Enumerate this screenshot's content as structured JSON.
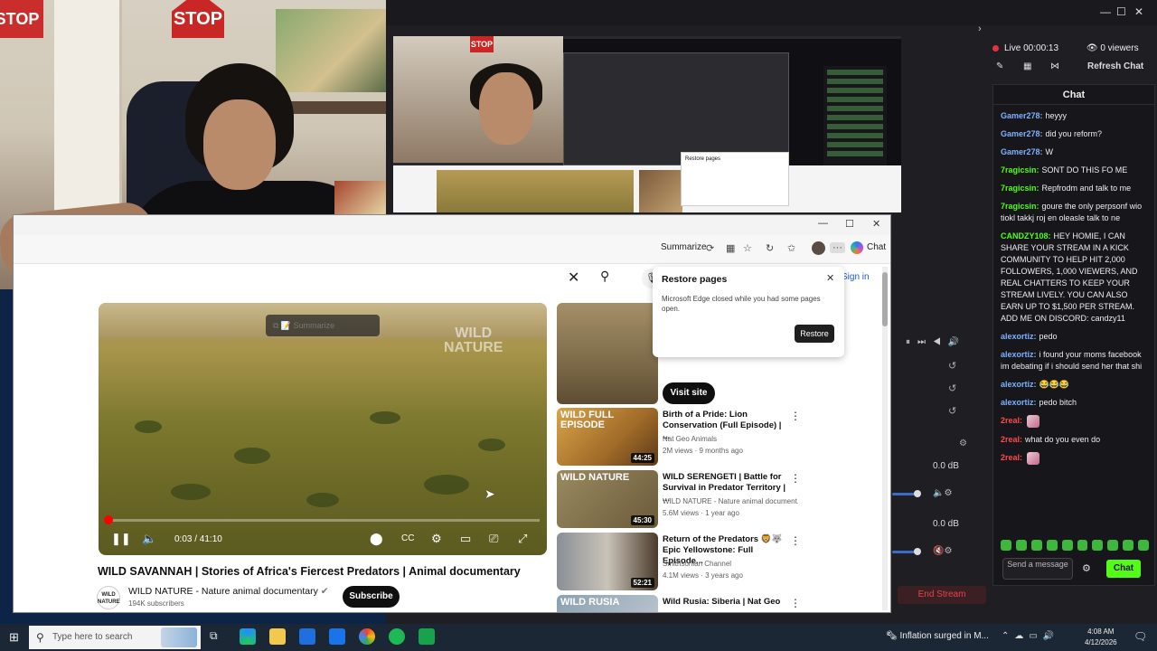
{
  "webcam": {
    "stop_sign": "STOP"
  },
  "obs": {
    "live_time": "Live 00:00:13",
    "viewers": "0 viewers",
    "refresh_chat": "Refresh Chat",
    "chat_title": "Chat",
    "send_placeholder": "Send a message",
    "send_label": "Chat",
    "end_stream": "End Stream",
    "db1": "0.0 dB",
    "db2": "0.0 dB",
    "preview_stop": "STOP",
    "preview_restore": "Restore pages",
    "messages": [
      {
        "user": "Gamer278:",
        "text": "heyyy",
        "color": "#7fb0ff"
      },
      {
        "user": "Gamer278:",
        "text": "did you reform?",
        "color": "#7fb0ff"
      },
      {
        "user": "Gamer278:",
        "text": "W",
        "color": "#7fb0ff"
      },
      {
        "user": "7ragicsin:",
        "text": "SONT DO THIS FO ME",
        "color": "#53fc18"
      },
      {
        "user": "7ragicsin:",
        "text": "Repfrodm and talk to me",
        "color": "#53fc18"
      },
      {
        "user": "7ragicsin:",
        "text": "goure the only perpsonf wio tiokl takkj roj en oleasle talk to ne",
        "color": "#53fc18"
      },
      {
        "user": "CANDZY108:",
        "text": "HEY HOMIE, I CAN SHARE YOUR STREAM IN A KICK COMMUNITY TO HELP HIT 2,000 FOLLOWERS, 1,000 VIEWERS, AND REAL CHATTERS TO KEEP YOUR STREAM LIVELY. YOU CAN ALSO EARN UP TO $1,500 PER STREAM. ADD ME ON DISCORD: candzy11",
        "color": "#53fc18"
      },
      {
        "user": "alexortiz:",
        "text": "pedo",
        "color": "#7fb0ff"
      },
      {
        "user": "alexortiz:",
        "text": "i found your moms facebook im debating if i should send her that shi",
        "color": "#7fb0ff"
      },
      {
        "user": "alexortiz:",
        "text": "😂😂😂",
        "color": "#7fb0ff"
      },
      {
        "user": "alexortiz:",
        "text": "pedo bitch",
        "color": "#7fb0ff"
      },
      {
        "user": "2real:",
        "text": "",
        "color": "#ff4b4b",
        "emote": true
      },
      {
        "user": "2real:",
        "text": "what do you even do",
        "color": "#ff4b4b"
      },
      {
        "user": "2real:",
        "text": "",
        "color": "#ff4b4b",
        "emote": true
      }
    ]
  },
  "browser": {
    "summarize": "Summarize",
    "chat": "Chat",
    "sign_in": "Sign in",
    "restore": {
      "title": "Restore pages",
      "body": "Microsoft Edge closed while you had some pages open.",
      "button": "Restore"
    },
    "player": {
      "watermark_1": "WILD",
      "watermark_2": "NATURE",
      "summarize": "Summarize",
      "time": "0:03 / 41:10",
      "progress": 0.001
    },
    "video_title": "WILD SAVANNAH | Stories of Africa's Fiercest Predators | Animal documentary",
    "channel": "WILD NATURE - Nature animal documentary",
    "channel_avatar": "WILD NATURE",
    "subscribers": "194K subscribers",
    "subscribe": "Subscribe",
    "visit_site": "Visit site",
    "recommendations": [
      {
        "title": "Birth of a Pride: Lion Conservation (Full Episode) | ...",
        "channel": "Nat Geo Animals",
        "meta": "2M views · 9 months ago",
        "duration": "44:25",
        "thumb_text": "WILD FULL EPISODE"
      },
      {
        "title": "WILD SERENGETI | Battle for Survival in Predator Territory | ...",
        "channel": "WILD NATURE - Nature animal document...",
        "meta": "5.6M views · 1 year ago",
        "duration": "45:30",
        "thumb_text": "WILD NATURE"
      },
      {
        "title": "Return of the Predators 🦁🐺 Epic Yellowstone: Full Episode...",
        "channel": "Smithsonian Channel",
        "meta": "4.1M views · 3 years ago",
        "duration": "52:21",
        "thumb_text": ""
      },
      {
        "title": "Wild Rusia: Siberia | Nat Geo",
        "channel": "",
        "meta": "",
        "duration": "",
        "thumb_text": "WILD RUSIA"
      }
    ]
  },
  "taskbar": {
    "search_placeholder": "Type here to search",
    "news": "Inflation surged in M...",
    "time": "4:08 AM",
    "date": "4/12/2026"
  }
}
